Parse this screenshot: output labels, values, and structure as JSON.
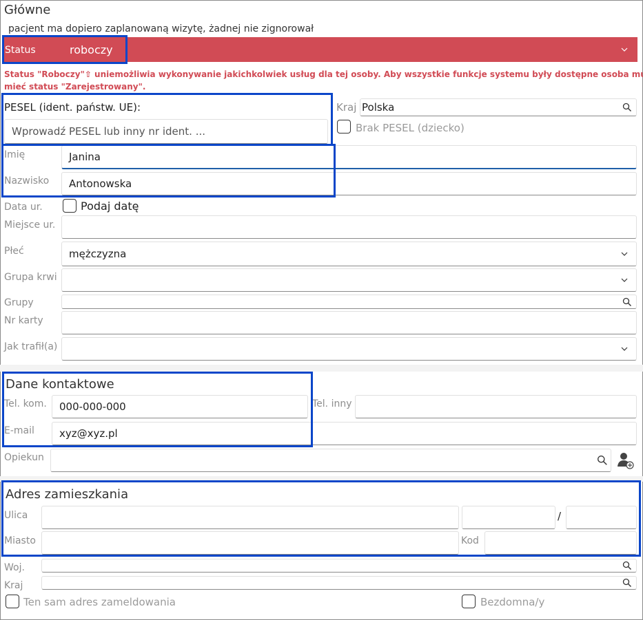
{
  "main": {
    "title": "Główne",
    "visit_note": "pacjent ma dopiero zaplanowaną wizytę, żadnej nie zignorował",
    "status_label": "Status",
    "status_value": "roboczy",
    "status_color": "#d14b55",
    "warning_text_1": "Status \"Roboczy\"⇧ uniemożliwia wykonywanie jakichkolwiek usług dla tej osoby. Aby wszystkie funkcje systemu były dostępne osoba musi",
    "warning_text_2": "mieć status \"Zarejestrowany\".",
    "warning_color": "#d14b55",
    "pesel_label": "PESEL (ident. państw. UE):",
    "pesel_placeholder": "Wprowadź PESEL lub inny nr ident. ...",
    "country_label": "Kraj",
    "country_value": "Polska",
    "no_pesel_label": "Brak PESEL (dziecko)",
    "first_name_label": "Imię",
    "first_name_value": "Janina",
    "last_name_label": "Nazwisko",
    "last_name_value": "Antonowska",
    "birth_date_label": "Data ur.",
    "birth_date_checkbox": "Podaj datę",
    "birth_place_label": "Miejsce ur.",
    "sex_label": "Płeć",
    "sex_value": "mężczyzna",
    "blood_label": "Grupa krwi",
    "groups_label": "Grupy",
    "card_label": "Nr karty",
    "source_label": "Jak trafił(a)"
  },
  "contact": {
    "title": "Dane kontaktowe",
    "mobile_label": "Tel. kom.",
    "mobile_value": "000-000-000",
    "other_phone_label": "Tel. inny",
    "email_label": "E-mail",
    "email_value": "xyz@xyz.pl",
    "guardian_label": "Opiekun"
  },
  "address": {
    "title": "Adres zamieszkania",
    "street_label": "Ulica",
    "slash": "/",
    "city_label": "Miasto",
    "zip_label": "Kod",
    "voivodeship_label": "Woj.",
    "country_label": "Kraj",
    "same_address_label": "Ten sam adres zameldowania",
    "homeless_label": "Bezdomna/y"
  }
}
